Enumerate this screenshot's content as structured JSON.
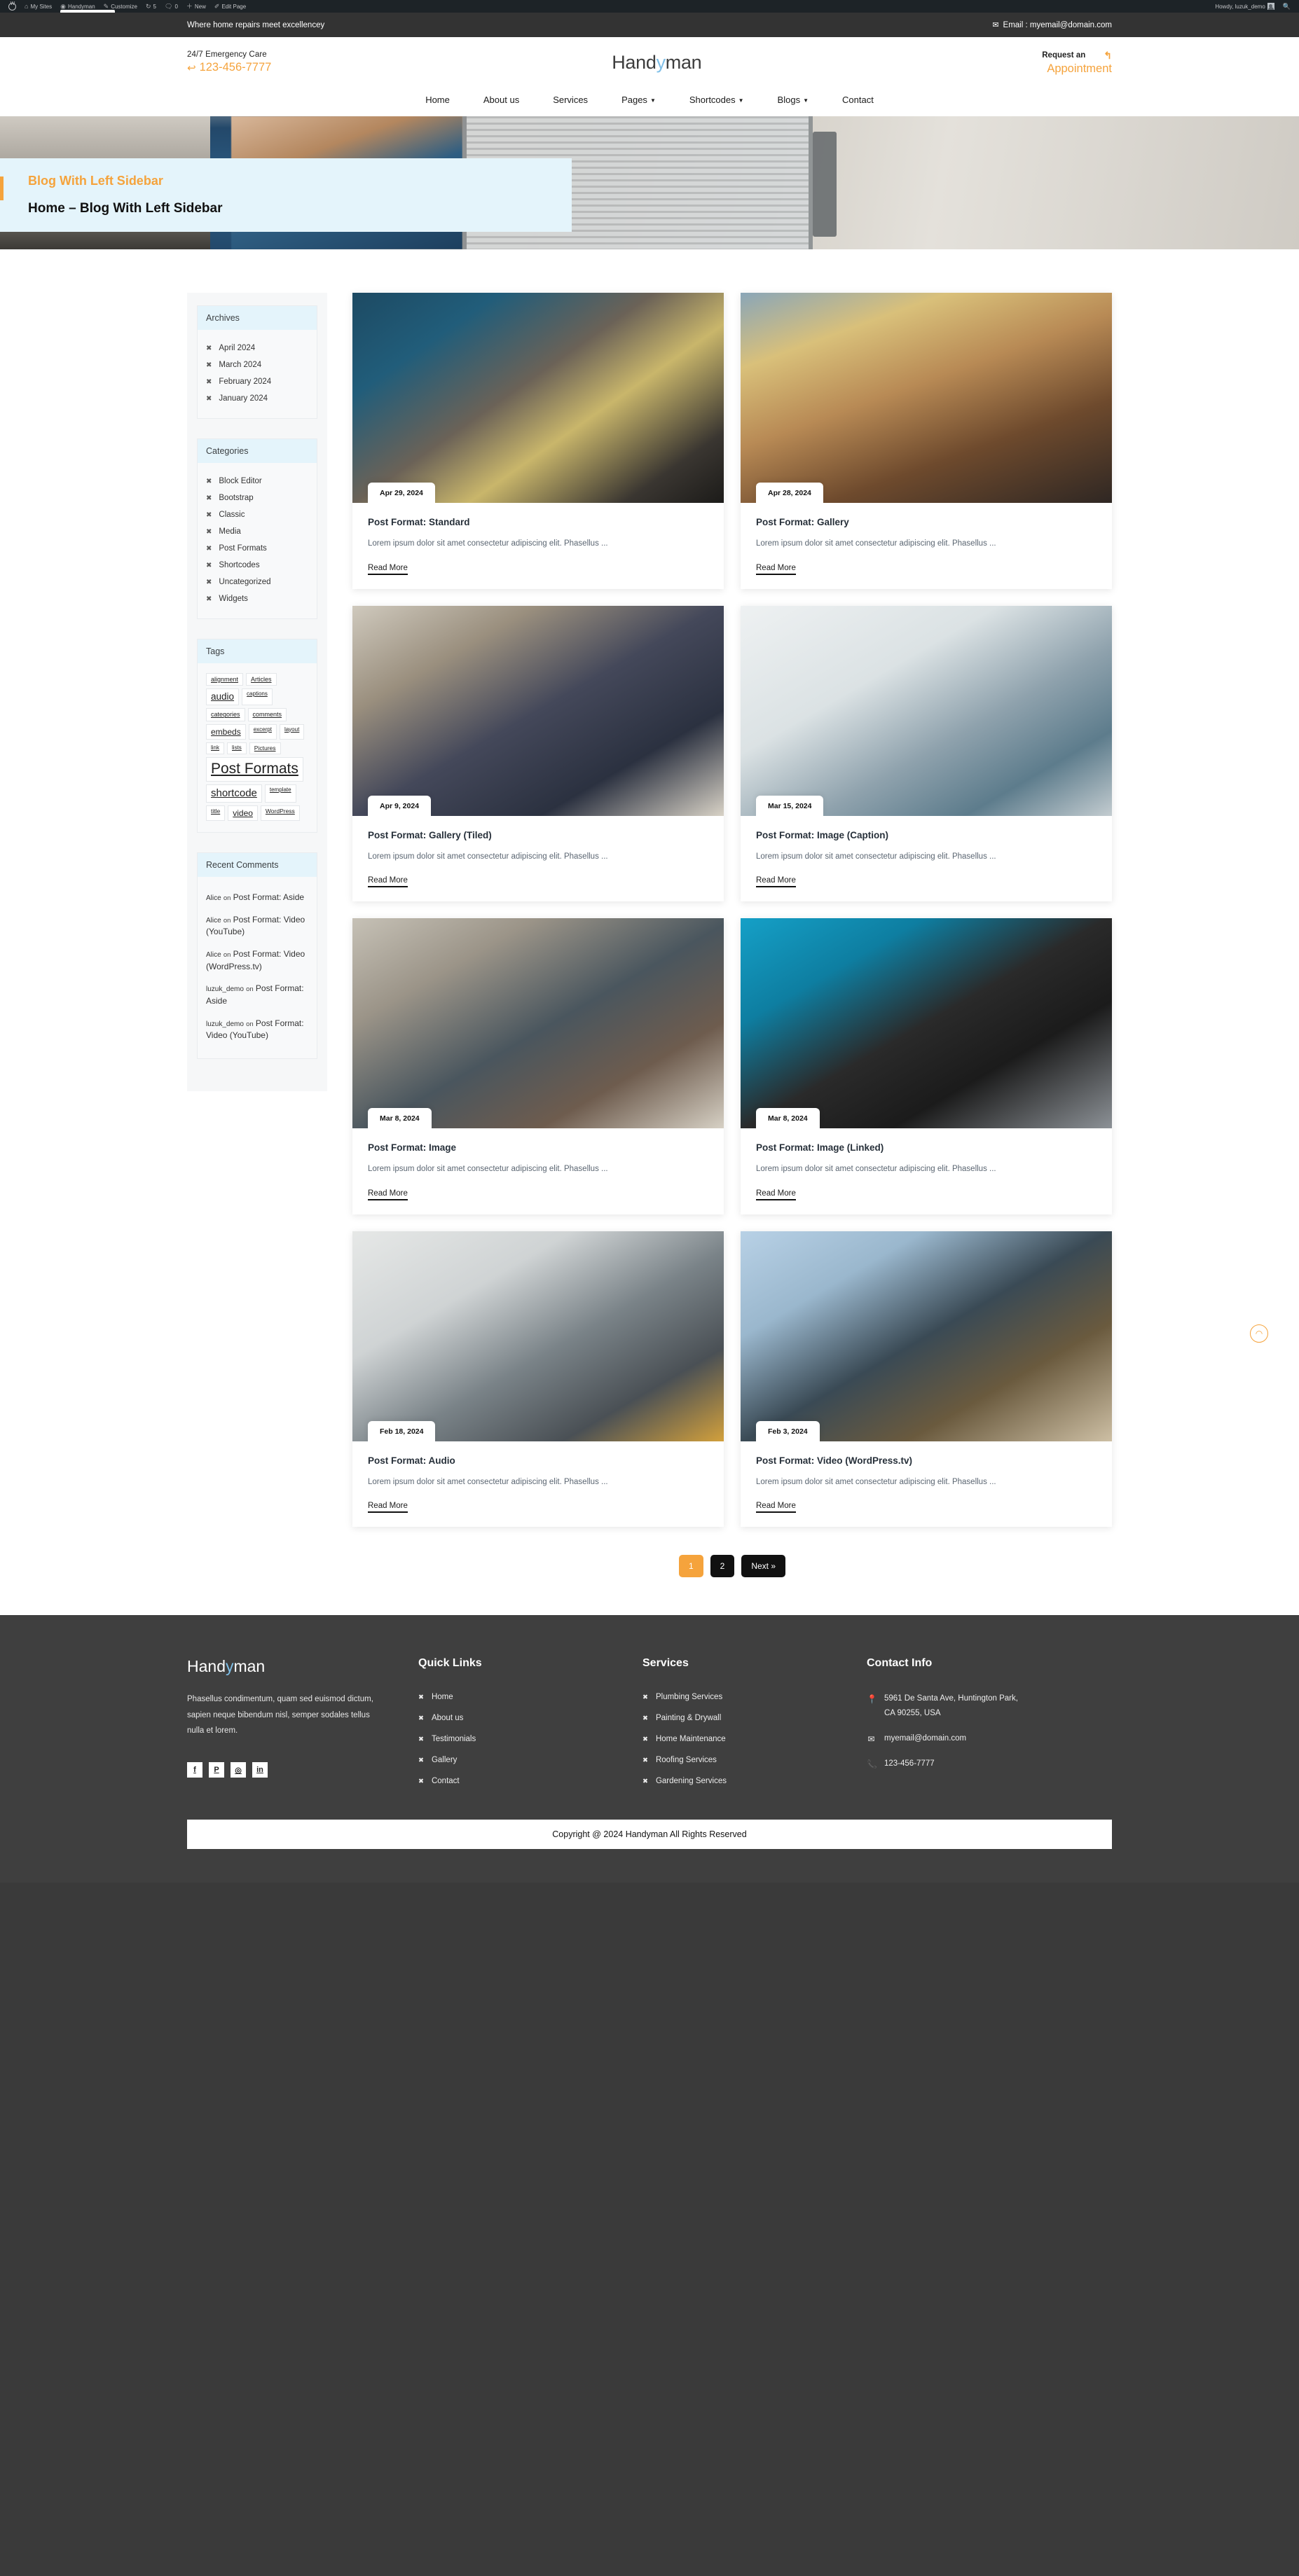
{
  "adminbar": {
    "items": [
      {
        "icon": "wordpress-logo",
        "label": ""
      },
      {
        "icon": "multisite-icon",
        "label": "My Sites"
      },
      {
        "icon": "dashboard-icon",
        "label": "Handyman"
      },
      {
        "icon": "pencil-icon",
        "label": "Customize"
      },
      {
        "icon": "updates-icon",
        "label": "5"
      },
      {
        "icon": "comment-icon",
        "label": "0"
      },
      {
        "icon": "plus-icon",
        "label": "New"
      },
      {
        "icon": "edit-icon",
        "label": "Edit Page"
      }
    ],
    "howdy": "Howdy, luzuk_demo",
    "search_icon": "search-icon"
  },
  "topbar": {
    "tagline": "Where home repairs meet excellencey",
    "email_label": "Email : myemail@domain.com",
    "email_icon": "envelope-icon"
  },
  "header": {
    "emergency_label": "24/7 Emergency Care",
    "phone": "123-456-7777",
    "logo_part1": "Hand",
    "logo_y": "y",
    "logo_part2": "man",
    "cta_line1": "Request an",
    "cta_line2": "Appointment"
  },
  "nav": {
    "items": [
      {
        "label": "Home",
        "caret": false
      },
      {
        "label": "About us",
        "caret": false
      },
      {
        "label": "Services",
        "caret": false
      },
      {
        "label": "Pages",
        "caret": true
      },
      {
        "label": "Shortcodes",
        "caret": true
      },
      {
        "label": "Blogs",
        "caret": true
      },
      {
        "label": "Contact",
        "caret": false
      }
    ]
  },
  "hero": {
    "title": "Blog With Left Sidebar",
    "breadcrumb": "Home – Blog With Left Sidebar"
  },
  "sidebar": {
    "archives": {
      "title": "Archives",
      "items": [
        "April 2024",
        "March 2024",
        "February 2024",
        "January 2024"
      ]
    },
    "categories": {
      "title": "Categories",
      "items": [
        "Block Editor",
        "Bootstrap",
        "Classic",
        "Media",
        "Post Formats",
        "Shortcodes",
        "Uncategorized",
        "Widgets"
      ]
    },
    "tags": {
      "title": "Tags",
      "items": [
        {
          "label": "alignment",
          "size": 9
        },
        {
          "label": "Articles",
          "size": 9
        },
        {
          "label": "audio",
          "size": 13.5
        },
        {
          "label": "captions",
          "size": 8
        },
        {
          "label": "categories",
          "size": 9
        },
        {
          "label": "comments",
          "size": 9
        },
        {
          "label": "embeds",
          "size": 12
        },
        {
          "label": "excerpt",
          "size": 8
        },
        {
          "label": "layout",
          "size": 8
        },
        {
          "label": "link",
          "size": 8
        },
        {
          "label": "lists",
          "size": 8
        },
        {
          "label": "Pictures",
          "size": 8.5
        },
        {
          "label": "Post Formats",
          "size": 21
        },
        {
          "label": "shortcode",
          "size": 15
        },
        {
          "label": "template",
          "size": 8
        },
        {
          "label": "title",
          "size": 8.5
        },
        {
          "label": "video",
          "size": 12
        },
        {
          "label": "WordPress",
          "size": 8.5
        }
      ]
    },
    "recent_comments": {
      "title": "Recent Comments",
      "items": [
        {
          "author": "Alice",
          "on": "on",
          "post": "Post Format: Aside"
        },
        {
          "author": "Alice",
          "on": "on",
          "post": "Post Format: Video (YouTube)"
        },
        {
          "author": "Alice",
          "on": "on",
          "post": "Post Format: Video (WordPress.tv)"
        },
        {
          "author": "luzuk_demo",
          "on": "on",
          "post": "Post Format: Aside"
        },
        {
          "author": "luzuk_demo",
          "on": "on",
          "post": "Post Format: Video (YouTube)"
        }
      ]
    }
  },
  "posts": {
    "read_more_label": "Read More",
    "excerpt": "Lorem ipsum dolor sit amet consectetur adipiscing elit. Phasellus ...",
    "items": [
      {
        "date": "Apr 29, 2024",
        "title": "Post Format: Standard",
        "img": "technician-repairing-electronics"
      },
      {
        "date": "Apr 28, 2024",
        "title": "Post Format: Gallery",
        "img": "worker-in-straw-hat"
      },
      {
        "date": "Apr 9, 2024",
        "title": "Post Format: Gallery (Tiled)",
        "img": "carpenter-measuring-board"
      },
      {
        "date": "Mar 15, 2024",
        "title": "Post Format: Image (Caption)",
        "img": "painter-on-ladder"
      },
      {
        "date": "Mar 8, 2024",
        "title": "Post Format: Image",
        "img": "plumber-soldering-pipe"
      },
      {
        "date": "Mar 8, 2024",
        "title": "Post Format: Image (Linked)",
        "img": "welder-with-mask"
      },
      {
        "date": "Feb 18, 2024",
        "title": "Post Format: Audio",
        "img": "plumber-under-sink"
      },
      {
        "date": "Feb 3, 2024",
        "title": "Post Format: Video (WordPress.tv)",
        "img": "construction-worker-smiling"
      }
    ]
  },
  "pagination": {
    "pages": [
      "1",
      "2"
    ],
    "next_label": "Next »",
    "active": "1"
  },
  "float_button": {
    "icon": "scroll-top-icon",
    "glyph": "◠"
  },
  "footer": {
    "logo_part1": "Hand",
    "logo_y": "y",
    "logo_part2": "man",
    "description": "Phasellus condimentum, quam sed euismod dictum, sapien neque bibendum nisl, semper sodales tellus nulla et lorem.",
    "socials": [
      {
        "name": "facebook-icon",
        "glyph": "f"
      },
      {
        "name": "pinterest-icon",
        "glyph": "P"
      },
      {
        "name": "instagram-icon",
        "glyph": "◎"
      },
      {
        "name": "linkedin-icon",
        "glyph": "in"
      }
    ],
    "quick_links": {
      "title": "Quick Links",
      "items": [
        "Home",
        "About us",
        "Testimonials",
        "Gallery",
        "Contact"
      ]
    },
    "services": {
      "title": "Services",
      "items": [
        "Plumbing Services",
        "Painting & Drywall",
        "Home Maintenance",
        "Roofing Services",
        "Gardening Services"
      ]
    },
    "contact": {
      "title": "Contact Info",
      "address": "5961 De Santa Ave, Huntington Park, CA 90255, USA",
      "email": "myemail@domain.com",
      "phone": "123-456-7777"
    },
    "copyright": "Copyright @ 2024 Handyman All Rights Reserved"
  },
  "colors": {
    "accent": "#f5a33c",
    "dark": "#333333",
    "light_blue": "#e4f4fb",
    "logo_blue": "#7fbfe8"
  }
}
